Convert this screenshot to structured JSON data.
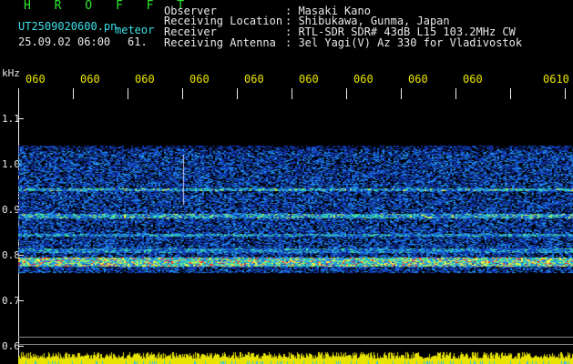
{
  "header": {
    "station_code": "H R O F F T",
    "filename": "UT2509020600.pn",
    "mode": "meteor",
    "datetime": "25.09.02 06:00",
    "count": "61."
  },
  "info": {
    "rows": [
      {
        "label": "Observer",
        "value": ": Masaki Kano"
      },
      {
        "label": "Receiving Location",
        "value": ": Shibukawa, Gunma, Japan"
      },
      {
        "label": "Receiver",
        "value": ": RTL-SDR SDR# 43dB L15 103.2MHz CW"
      },
      {
        "label": "Receiving Antenna",
        "value": ": 3el Yagi(V) Az 330 for Vladivostok"
      }
    ]
  },
  "axis": {
    "y_unit": "kHz",
    "y_ticks": [
      "1.1",
      "1.0",
      "0.9",
      "0.8",
      "0.7",
      "0.6"
    ],
    "x_ticks": [
      "060",
      "060",
      "060",
      "060",
      "060",
      "060",
      "060",
      "060",
      "060",
      "0610"
    ]
  },
  "colors": {
    "background": "#000000",
    "title_green": "#2ee82e",
    "info_cyan": "#3ee0e8",
    "tick_yellow": "#e8e400",
    "signal_bar": "#e8e400"
  }
}
